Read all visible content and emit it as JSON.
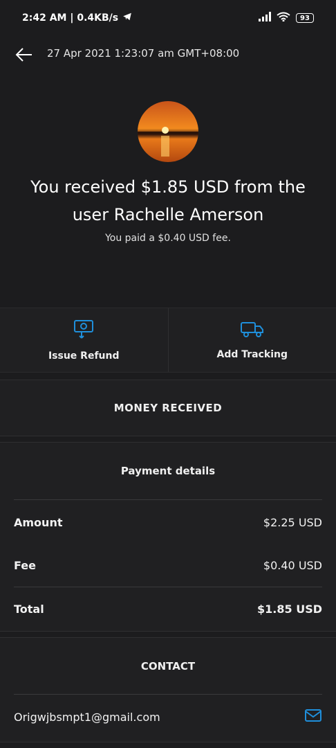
{
  "status_bar": {
    "time_speed": "2:42 AM | 0.4KB/s",
    "battery": "93"
  },
  "header": {
    "datetime": "27 Apr 2021 1:23:07 am GMT+08:00"
  },
  "hero": {
    "title": "You received $1.85 USD from the user Rachelle Amerson",
    "subtitle": "You paid a $0.40 USD fee."
  },
  "actions": {
    "issue_refund": "Issue Refund",
    "add_tracking": "Add Tracking"
  },
  "status_section": {
    "title": "MONEY RECEIVED"
  },
  "payment": {
    "title": "Payment details",
    "rows": [
      {
        "label": "Amount",
        "value": "$2.25 USD"
      },
      {
        "label": "Fee",
        "value": "$0.40 USD"
      },
      {
        "label": "Total",
        "value": "$1.85 USD"
      }
    ]
  },
  "contact": {
    "title": "CONTACT",
    "email": "Origwjbsmpt1@gmail.com"
  },
  "colors": {
    "background": "#1c1c1e",
    "card": "#202022",
    "accent_blue": "#1f8fdb"
  },
  "icons": {
    "back": "arrow-left-icon",
    "refund": "refund-icon",
    "tracking": "truck-icon",
    "email": "envelope-icon"
  }
}
